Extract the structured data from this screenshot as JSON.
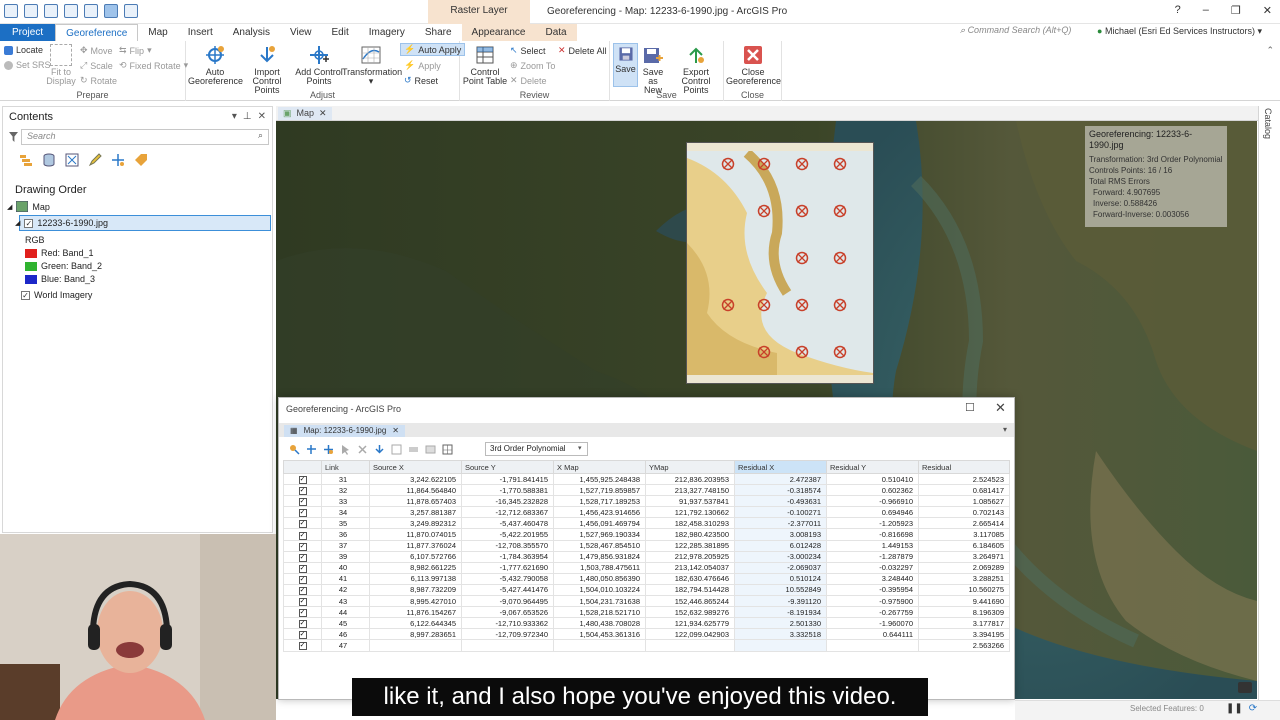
{
  "window_title": "Georeferencing - Map: 12233-6-1990.jpg - ArcGIS Pro",
  "context_tab_group": "Raster Layer",
  "window_controls": {
    "help": "?",
    "minimize": "–",
    "restore": "❐",
    "close": "✕"
  },
  "tabs": [
    {
      "label": "Project"
    },
    {
      "label": "Georeference"
    },
    {
      "label": "Map"
    },
    {
      "label": "Insert"
    },
    {
      "label": "Analysis"
    },
    {
      "label": "View"
    },
    {
      "label": "Edit"
    },
    {
      "label": "Imagery"
    },
    {
      "label": "Share"
    },
    {
      "label": "Appearance"
    },
    {
      "label": "Data"
    }
  ],
  "command_search_placeholder": "Command Search (Alt+Q)",
  "user": "Michael (Esri Ed Services Instructors)",
  "ribbon": {
    "prepare": {
      "label": "Prepare",
      "locate": "Locate",
      "set_srs": "Set SRS",
      "fit_line1": "Fit to",
      "fit_line2": "Display",
      "move": "Move",
      "scale": "Scale",
      "rotate": "Rotate",
      "flip": "Flip",
      "fixed_rotate": "Fixed Rotate"
    },
    "adjust": {
      "label": "Adjust",
      "auto_line1": "Auto",
      "auto_line2": "Georeference",
      "import_line1": "Import",
      "import_line2": "Control Points",
      "add_line1": "Add Control",
      "add_line2": "Points",
      "transformation": "Transformation",
      "auto_apply": "Auto Apply",
      "apply": "Apply",
      "reset": "Reset"
    },
    "review": {
      "label": "Review",
      "cpt_line1": "Control",
      "cpt_line2": "Point Table",
      "select": "Select",
      "zoom_to": "Zoom To",
      "delete": "Delete",
      "delete_all": "Delete All"
    },
    "save": {
      "label": "Save",
      "save": "Save",
      "save_as_line1": "Save as",
      "save_as_line2": "New",
      "export_line1": "Export",
      "export_line2": "Control Points"
    },
    "close": {
      "label": "Close",
      "close_line1": "Close",
      "close_line2": "Georeference"
    }
  },
  "contents": {
    "title": "Contents",
    "search_placeholder": "Search",
    "drawing_order": "Drawing Order",
    "map_label": "Map",
    "layer": "12233-6-1990.jpg",
    "rgb": "RGB",
    "bands": [
      {
        "label": "Red:  Band_1",
        "color": "#e0201c"
      },
      {
        "label": "Green:  Band_2",
        "color": "#2fb32f"
      },
      {
        "label": "Blue:  Band_3",
        "color": "#1c28c8"
      }
    ],
    "basemap": "World Imagery"
  },
  "map_tab": "Map",
  "catalog_label": "Catalog",
  "info_panel": {
    "title": "Georeferencing: 12233-6-1990.jpg",
    "lines": [
      "Transformation: 3rd Order Polynomial",
      "Controls Points: 16 / 16",
      "Total RMS Errors",
      "  Forward: 4.907695",
      "  Inverse: 0.588426",
      "  Forward-Inverse: 0.003056"
    ]
  },
  "dialog": {
    "title": "Georeferencing - ArcGIS Pro",
    "tab": "Map: 12233-6-1990.jpg",
    "transformation": "3rd Order Polynomial",
    "columns": [
      "",
      "Link",
      "Source X",
      "Source Y",
      "X Map",
      "YMap",
      "Residual X",
      "Residual Y",
      "Residual"
    ],
    "rows": [
      [
        "31",
        "3,242.622105",
        "-1,791.841415",
        "1,455,925.248438",
        "212,836.203953",
        "2.472387",
        "0.510410",
        "2.524523"
      ],
      [
        "32",
        "11,864.564840",
        "-1,770.588381",
        "1,527,719.859857",
        "213,327.748150",
        "-0.318574",
        "0.602362",
        "0.681417"
      ],
      [
        "33",
        "11,878.657403",
        "-16,345.232828",
        "1,528,717.189253",
        "91,937.537841",
        "-0.493631",
        "-0.966910",
        "1.085627"
      ],
      [
        "34",
        "3,257.881387",
        "-12,712.683367",
        "1,456,423.914656",
        "121,792.130662",
        "-0.100271",
        "0.694946",
        "0.702143"
      ],
      [
        "35",
        "3,249.892312",
        "-5,437.460478",
        "1,456,091.469794",
        "182,458.310293",
        "-2.377011",
        "-1.205923",
        "2.665414"
      ],
      [
        "36",
        "11,870.074015",
        "-5,422.201955",
        "1,527,969.190334",
        "182,980.423500",
        "3.008193",
        "-0.816698",
        "3.117085"
      ],
      [
        "37",
        "11,877.376024",
        "-12,708.355570",
        "1,528,467.854510",
        "122,285.381895",
        "6.012428",
        "1.449153",
        "6.184605"
      ],
      [
        "39",
        "6,107.572766",
        "-1,784.363954",
        "1,479,856.931824",
        "212,978.205925",
        "-3.000234",
        "-1.287879",
        "3.264971"
      ],
      [
        "40",
        "8,982.661225",
        "-1,777.621690",
        "1,503,788.475611",
        "213,142.054037",
        "-2.069037",
        "-0.032297",
        "2.069289"
      ],
      [
        "41",
        "6,113.997138",
        "-5,432.790058",
        "1,480,050.856390",
        "182,630.476646",
        "0.510124",
        "3.248440",
        "3.288251"
      ],
      [
        "42",
        "8,987.732209",
        "-5,427.441476",
        "1,504,010.103224",
        "182,794.514428",
        "10.552849",
        "-0.395954",
        "10.560275"
      ],
      [
        "43",
        "8,995.427010",
        "-9,070.964495",
        "1,504,231.731638",
        "152,446.865244",
        "-9.391120",
        "-0.975900",
        "9.441690"
      ],
      [
        "44",
        "11,876.154267",
        "-9,067.653526",
        "1,528,218.521710",
        "152,632.989276",
        "-8.191934",
        "-0.267759",
        "8.196309"
      ],
      [
        "45",
        "6,122.644345",
        "-12,710.933362",
        "1,480,438.708028",
        "121,934.625779",
        "2.501330",
        "-1.960070",
        "3.177817"
      ],
      [
        "46",
        "8,997.283651",
        "-12,709.972340",
        "1,504,453.361316",
        "122,099.042903",
        "3.332518",
        "0.644111",
        "3.394195"
      ],
      [
        "47",
        "",
        "",
        "",
        "",
        "",
        "",
        "2.563266"
      ]
    ]
  },
  "status": "Selected Features: 0",
  "caption": "like it, and I also hope you've enjoyed this video."
}
